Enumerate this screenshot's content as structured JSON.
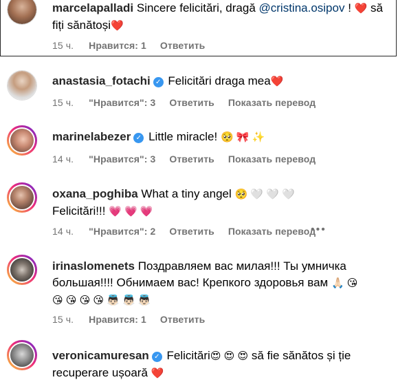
{
  "comments": [
    {
      "username": "marcelapalladi",
      "verified": false,
      "text_a": "Sincere felicitări, dragă ",
      "mention": "@cristina.osipov",
      "text_b": " ! ",
      "heart": "❤️",
      "text_c": " să",
      "text_line2": "fiți sănătoși",
      "heart2": "❤️",
      "time": "15 ч.",
      "likes": "Нравится: 1",
      "reply": "Ответить"
    },
    {
      "username": "anastasia_fotachi",
      "verified": true,
      "text": "Felicitări draga mea",
      "heart": "❤️",
      "time": "15 ч.",
      "likes": "\"Нравится\": 3",
      "reply": "Ответить",
      "translate": "Показать перевод"
    },
    {
      "username": "marinelabezer",
      "verified": true,
      "text": "Little miracle!",
      "emoji": "🥺 🎀 ✨",
      "time": "14 ч.",
      "likes": "\"Нравится\": 3",
      "reply": "Ответить",
      "translate": "Показать перевод"
    },
    {
      "username": "oxana_poghiba",
      "verified": false,
      "text": "What a tiny angel",
      "emoji": "🥺 🤍 🤍 🤍",
      "text_line2": "Felicitări!!!",
      "emoji2": "💗 💗 💗",
      "time": "14 ч.",
      "likes": "\"Нравится\": 2",
      "reply": "Ответить",
      "translate": "Показать перевод",
      "more": "•••"
    },
    {
      "username": "irinaslomenets",
      "verified": false,
      "text": "Поздравляем вас милая!!! Ты умничка",
      "text_line2": "большая!!!! Обнимаем вас! Крепкого здоровья вам",
      "emoji_line2": "🙏🏻 😘",
      "emoji_line3": "😘 😘 😘 😘 👼🏻 👼🏻 👼🏻",
      "time": "15 ч.",
      "likes": "Нравится: 1",
      "reply": "Ответить"
    },
    {
      "username": "veronicamuresan",
      "verified": true,
      "text_a": "Felicitări",
      "emoji": "😍 😍 😍",
      "text_b": "să fie sănătos și ție",
      "text_line2": "recuperare ușoară",
      "heart": "❤️"
    }
  ],
  "colors": {
    "username": "#262626",
    "meta": "#737373",
    "mention": "#00376b",
    "verified": "#3897f0",
    "heart": "#ed1c3f"
  }
}
